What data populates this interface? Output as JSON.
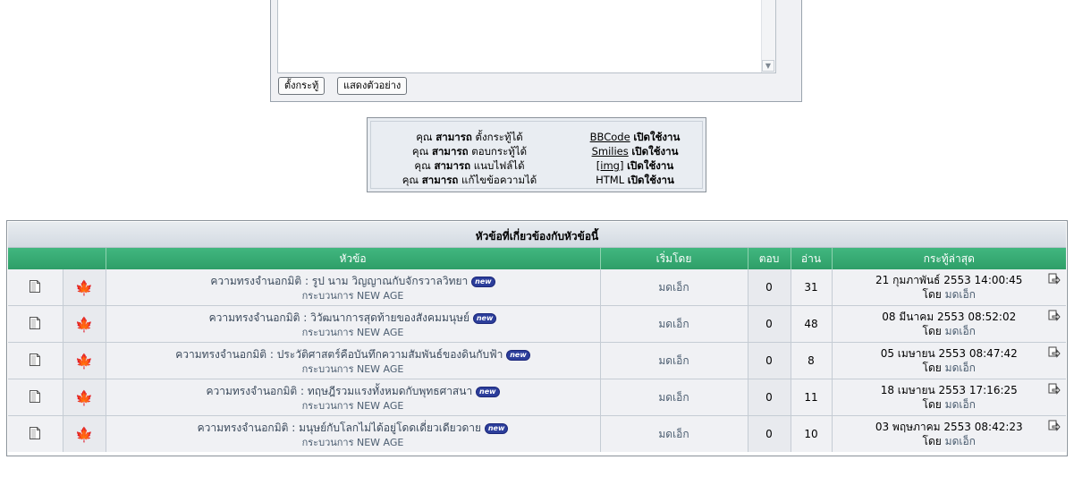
{
  "reply_form": {
    "post_button": "ตั้งกระทู้",
    "preview_button": "แสดงตัวอย่าง"
  },
  "permissions": {
    "left": [
      {
        "prefix": "คุณ",
        "can": "สามารถ",
        "action": "ตั้งกระทู้ได้"
      },
      {
        "prefix": "คุณ",
        "can": "สามารถ",
        "action": "ตอบกระทู้ได้"
      },
      {
        "prefix": "คุณ",
        "can": "สามารถ",
        "action": "แนบไฟล์ได้"
      },
      {
        "prefix": "คุณ",
        "can": "สามารถ",
        "action": "แก้ไขข้อความได้"
      }
    ],
    "right": [
      {
        "name": "BBCode",
        "status": "เปิดใช้งาน"
      },
      {
        "name": "Smilies",
        "status": "เปิดใช้งาน"
      },
      {
        "name": "[img]",
        "status": "เปิดใช้งาน"
      },
      {
        "name": "HTML",
        "status": "เปิดใช้งาน"
      }
    ]
  },
  "related": {
    "title": "หัวข้อที่เกี่ยวข้องกับหัวข้อนี้",
    "headers": {
      "topic": "หัวข้อ",
      "started_by": "เริ่มโดย",
      "replies": "ตอบ",
      "views": "อ่าน",
      "last_post": "กระทู้ล่าสุด"
    },
    "badge": "new",
    "by_label": "โดย",
    "rows": [
      {
        "title": "ความทรงจำนอกมิติ : รูป นาม วิญญาณกับจักรวาลวิทยา",
        "forum": "กระบวนการ NEW AGE",
        "author": "มดเอ็ก",
        "replies": "0",
        "views": "31",
        "date": "21 กุมภาพันธ์ 2553 14:00:45",
        "last_by": "มดเอ็ก"
      },
      {
        "title": "ความทรงจำนอกมิติ : วิวัฒนาการสุดท้ายของสังคมมนุษย์",
        "forum": "กระบวนการ NEW AGE",
        "author": "มดเอ็ก",
        "replies": "0",
        "views": "48",
        "date": "08 มีนาคม 2553 08:52:02",
        "last_by": "มดเอ็ก"
      },
      {
        "title": "ความทรงจำนอกมิติ : ประวัติศาสตร์คือบันทึกความสัมพันธ์ของดินกับฟ้า",
        "forum": "กระบวนการ NEW AGE",
        "author": "มดเอ็ก",
        "replies": "0",
        "views": "8",
        "date": "05 เมษายน 2553 08:47:42",
        "last_by": "มดเอ็ก"
      },
      {
        "title": "ความทรงจำนอกมิติ : ทฤษฎีรวมแรงทั้งหมดกับพุทธศาสนา",
        "forum": "กระบวนการ NEW AGE",
        "author": "มดเอ็ก",
        "replies": "0",
        "views": "11",
        "date": "18 เมษายน 2553 17:16:25",
        "last_by": "มดเอ็ก"
      },
      {
        "title": "ความทรงจำนอกมิติ : มนุษย์กับโลกไม่ได้อยู่โดดเดี่ยวเดียวดาย",
        "forum": "กระบวนการ NEW AGE",
        "author": "มดเอ็ก",
        "replies": "0",
        "views": "10",
        "date": "03 พฤษภาคม 2553 08:42:23",
        "last_by": "มดเอ็ก"
      }
    ]
  }
}
